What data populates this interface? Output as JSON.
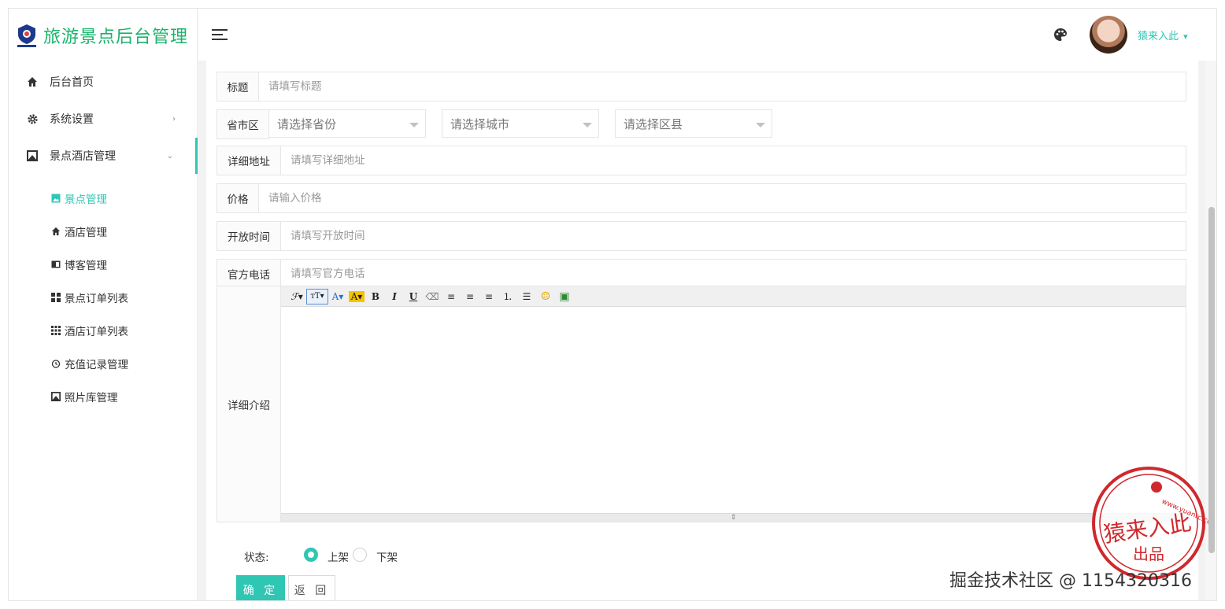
{
  "app": {
    "title": "旅游景点后台管理",
    "logo_text": "猿来入此"
  },
  "sidebar": {
    "items": [
      {
        "label": "后台首页",
        "icon": "home-icon"
      },
      {
        "label": "系统设置",
        "icon": "gear-icon",
        "chevron": "›"
      },
      {
        "label": "景点酒店管理",
        "icon": "image-icon",
        "chevron": "⌄",
        "expanded": true
      }
    ],
    "sub_items": [
      {
        "label": "景点管理",
        "icon": "picture-icon",
        "active": true
      },
      {
        "label": "酒店管理",
        "icon": "home-icon"
      },
      {
        "label": "博客管理",
        "icon": "book-icon"
      },
      {
        "label": "景点订单列表",
        "icon": "grid-icon"
      },
      {
        "label": "酒店订单列表",
        "icon": "dots-grid-icon"
      },
      {
        "label": "充值记录管理",
        "icon": "clock-icon"
      },
      {
        "label": "照片库管理",
        "icon": "gallery-icon"
      }
    ]
  },
  "header": {
    "username": "猿来入此",
    "user_caret": "▾"
  },
  "form": {
    "title": {
      "label": "标题",
      "placeholder": "请填写标题"
    },
    "region": {
      "label": "省市区",
      "province_placeholder": "请选择省份",
      "city_placeholder": "请选择城市",
      "district_placeholder": "请选择区县"
    },
    "address": {
      "label": "详细地址",
      "placeholder": "请填写详细地址"
    },
    "price": {
      "label": "价格",
      "placeholder": "请输入价格"
    },
    "open_time": {
      "label": "开放时间",
      "placeholder": "请填写开放时间"
    },
    "phone": {
      "label": "官方电话",
      "placeholder": "请填写官方电话"
    },
    "description": {
      "label": "详细介绍"
    },
    "status": {
      "label": "状态:",
      "options": [
        {
          "label": "上架",
          "checked": true
        },
        {
          "label": "下架",
          "checked": false
        }
      ]
    },
    "buttons": {
      "confirm": "确 定",
      "back": "返 回"
    }
  },
  "editor_toolbar": {
    "buttons": [
      {
        "glyph": "ℱ▾",
        "icon": "font-family-icon"
      },
      {
        "glyph": "тT▾",
        "icon": "font-size-icon"
      },
      {
        "glyph": "A▾",
        "icon": "font-color-icon"
      },
      {
        "glyph": "A▾",
        "icon": "highlight-icon"
      },
      {
        "glyph": "B",
        "icon": "bold-icon"
      },
      {
        "glyph": "I",
        "icon": "italic-icon"
      },
      {
        "glyph": "U",
        "icon": "underline-icon"
      },
      {
        "glyph": "⌫",
        "icon": "eraser-icon"
      },
      {
        "glyph": "≡",
        "icon": "align-left-icon"
      },
      {
        "glyph": "≡",
        "icon": "align-center-icon"
      },
      {
        "glyph": "≡",
        "icon": "align-right-icon"
      },
      {
        "glyph": "⒈",
        "icon": "ordered-list-icon"
      },
      {
        "glyph": "☰",
        "icon": "unordered-list-icon"
      },
      {
        "glyph": "☺",
        "icon": "emoji-icon"
      },
      {
        "glyph": "▣",
        "icon": "insert-image-icon"
      }
    ]
  },
  "stamp": {
    "main_text": "猿来入此",
    "sub_text": "出品",
    "url_text": "www.yuanrc.com"
  },
  "watermark": {
    "text": "掘金技术社区 @ 1154320316"
  },
  "colors": {
    "accent": "#2fc6b4",
    "logo_green": "#19b36b",
    "stamp_red": "#d0282c"
  }
}
